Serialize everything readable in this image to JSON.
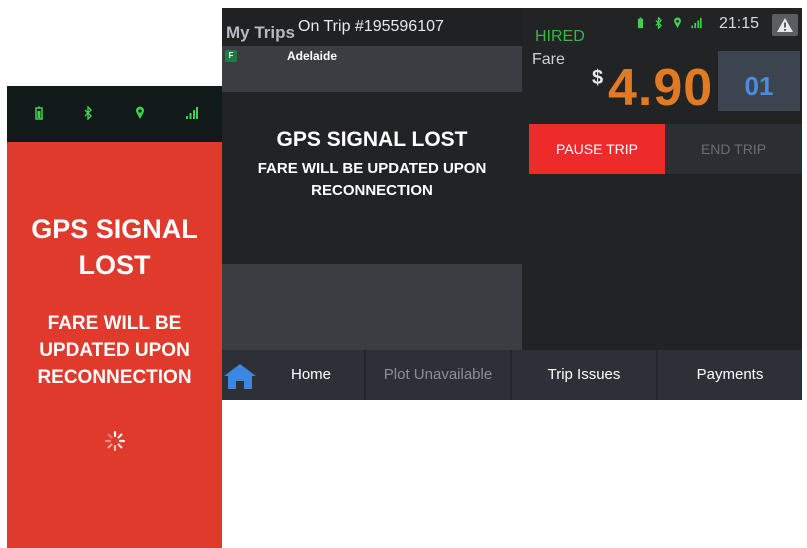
{
  "phone": {
    "status_icons": [
      "battery-icon",
      "bluetooth-icon",
      "location-icon",
      "signal-icon"
    ],
    "title_line1": "GPS SIGNAL",
    "title_line2": "LOST",
    "sub_line1": "FARE WILL BE",
    "sub_line2": "UPDATED UPON",
    "sub_line3": "RECONNECTION"
  },
  "tablet": {
    "title": "My Trips",
    "trip": "On Trip #195596107",
    "badge": "F",
    "city": "Adelaide",
    "lost_title": "GPS SIGNAL LOST",
    "lost_sub_line1": "FARE WILL BE UPDATED UPON",
    "lost_sub_line2": "RECONNECTION",
    "status_label": "HIRED",
    "fare_label": "Fare",
    "currency": "$",
    "fare_amount": "4.90",
    "tile_number": "01",
    "clock": "21:15",
    "pause_button": "PAUSE TRIP",
    "end_button": "END TRIP",
    "nav": {
      "home": "Home",
      "plot": "Plot Unavailable",
      "issues": "Trip Issues",
      "payments": "Payments"
    }
  },
  "colors": {
    "alert_red": "#e03a2c",
    "fare_orange": "#e17a24",
    "hired_green": "#3bb54a",
    "tile_blue": "#4b8be0",
    "pause_red": "#ee2b2b"
  }
}
